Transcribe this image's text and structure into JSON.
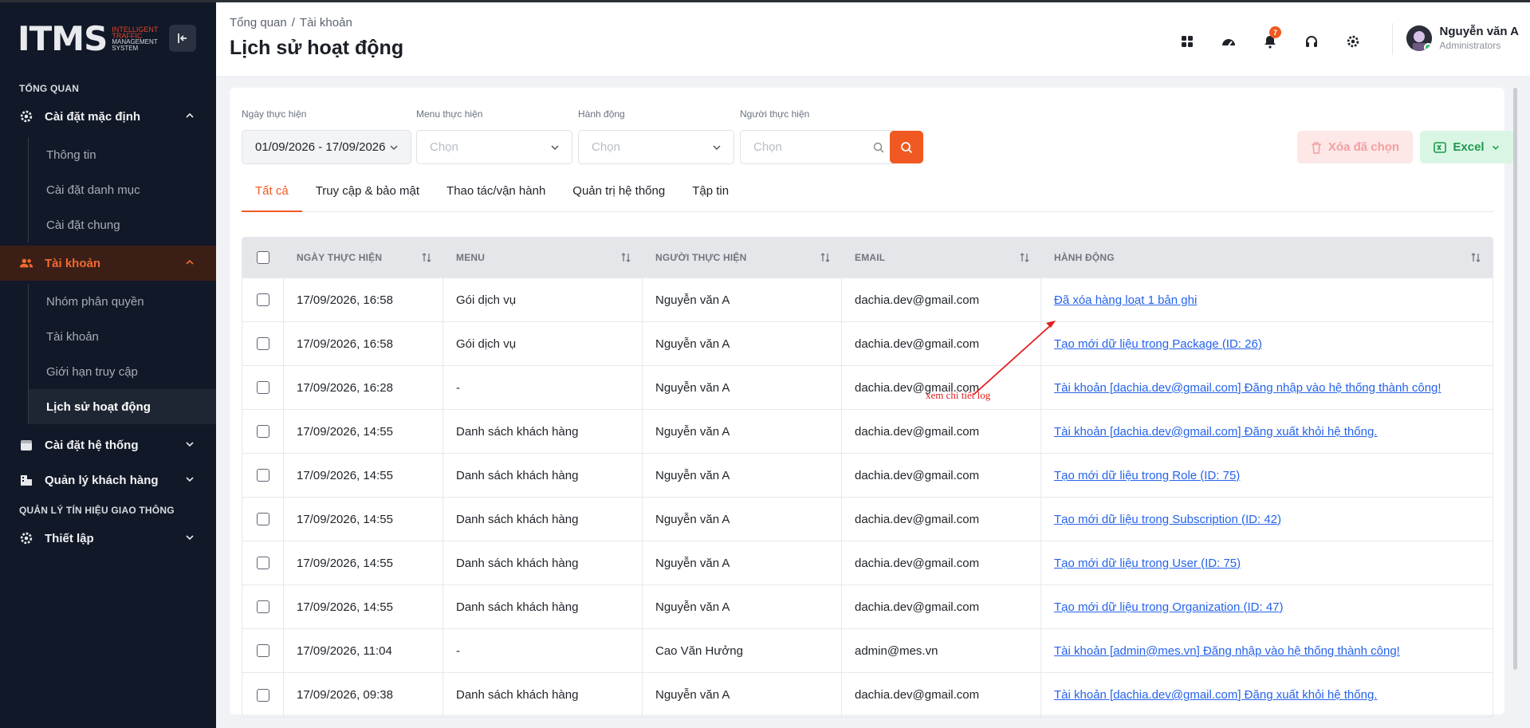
{
  "sidebar": {
    "logo": {
      "mark": "ITMS",
      "line1": "INTELLIGENT",
      "line2": "TRAFFIC",
      "line3": "MANAGEMENT",
      "line4": "SYSTEM"
    },
    "section_overview": "TỔNG QUAN",
    "default_settings": "Cài đặt mặc định",
    "default_sub": [
      "Thông tin",
      "Cài đặt danh mục",
      "Cài đặt chung"
    ],
    "accounts": "Tài khoản",
    "accounts_sub": [
      "Nhóm phân quyền",
      "Tài khoản",
      "Giới hạn truy cập",
      "Lịch sử hoạt động"
    ],
    "system_settings": "Cài đặt hệ thống",
    "customers": "Quản lý khách hàng",
    "section_traffic": "QUẢN LÝ TÍN HIỆU GIAO THÔNG",
    "setup": "Thiết lập"
  },
  "header": {
    "breadcrumb": [
      "Tổng quan",
      "/",
      "Tài khoản"
    ],
    "title": "Lịch sử hoạt động",
    "notifications": "7",
    "user_name": "Nguyễn văn A",
    "user_role": "Administrators"
  },
  "filters": {
    "date_label": "Ngày thực hiện",
    "date_value": "01/09/2026 - 17/09/2026",
    "menu_label": "Menu thực hiện",
    "menu_placeholder": "Chọn",
    "action_label": "Hành động",
    "action_placeholder": "Chọn",
    "user_label": "Người thực hiện",
    "user_placeholder": "Chọn",
    "delete_label": "Xóa đã chọn",
    "excel_label": "Excel"
  },
  "tabs": [
    "Tất cả",
    "Truy cập & bảo mật",
    "Thao tác/vận hành",
    "Quản trị hệ thống",
    "Tập tin"
  ],
  "table": {
    "headers": [
      "NGÀY THỰC HIỆN",
      "MENU",
      "NGƯỜI THỰC HIỆN",
      "EMAIL",
      "HÀNH ĐỘNG"
    ],
    "rows": [
      [
        "17/09/2026, 16:58",
        "Gói dịch vụ",
        "Nguyễn văn A",
        "dachia.dev@gmail.com",
        "Đã xóa hàng loạt 1 bản ghi"
      ],
      [
        "17/09/2026, 16:58",
        "Gói dịch vụ",
        "Nguyễn văn A",
        "dachia.dev@gmail.com",
        "Tạo mới dữ liệu trong Package (ID: 26)"
      ],
      [
        "17/09/2026, 16:28",
        "-",
        "Nguyễn văn A",
        "dachia.dev@gmail.com",
        "Tài khoản [dachia.dev@gmail.com] Đăng nhập vào hệ thống thành công!"
      ],
      [
        "17/09/2026, 14:55",
        "Danh sách khách hàng",
        "Nguyễn văn A",
        "dachia.dev@gmail.com",
        "Tài khoản [dachia.dev@gmail.com] Đăng xuất khỏi hệ thống."
      ],
      [
        "17/09/2026, 14:55",
        "Danh sách khách hàng",
        "Nguyễn văn A",
        "dachia.dev@gmail.com",
        "Tạo mới dữ liệu trong Role (ID: 75)"
      ],
      [
        "17/09/2026, 14:55",
        "Danh sách khách hàng",
        "Nguyễn văn A",
        "dachia.dev@gmail.com",
        "Tạo mới dữ liệu trong Subscription (ID: 42)"
      ],
      [
        "17/09/2026, 14:55",
        "Danh sách khách hàng",
        "Nguyễn văn A",
        "dachia.dev@gmail.com",
        "Tạo mới dữ liệu trong User (ID: 75)"
      ],
      [
        "17/09/2026, 14:55",
        "Danh sách khách hàng",
        "Nguyễn văn A",
        "dachia.dev@gmail.com",
        "Tạo mới dữ liệu trong Organization (ID: 47)"
      ],
      [
        "17/09/2026, 11:04",
        "-",
        "Cao Văn Hưởng",
        "admin@mes.vn",
        "Tài khoản [admin@mes.vn] Đăng nhập vào hệ thống thành công!"
      ],
      [
        "17/09/2026, 09:38",
        "Danh sách khách hàng",
        "Nguyễn văn A",
        "dachia.dev@gmail.com",
        "Tài khoản [dachia.dev@gmail.com] Đăng xuất khỏi hệ thống."
      ]
    ]
  },
  "annotation": "xem chi tiết log",
  "colors": {
    "accent": "#f05a22",
    "sidebar_bg": "#111827",
    "link": "#2563eb",
    "annotation": "#e11d1d"
  }
}
